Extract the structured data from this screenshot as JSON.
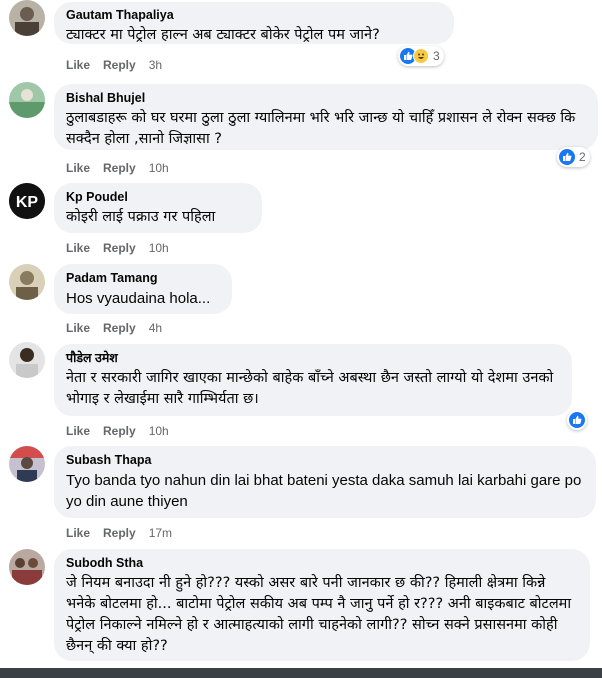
{
  "actions": {
    "like": "Like",
    "reply": "Reply"
  },
  "colors": {
    "bubble": "#f0f2f5",
    "like_blue": "#1877f2",
    "muted": "#65676b"
  },
  "comments": [
    {
      "name": "Gautam Thapaliya",
      "text": "ट्याक्टर मा पेट्रोल हाल्न अब ट्याक्टर बोकेर पेट्रोल पम जाने?",
      "time": "3h",
      "reaction_count": "3",
      "reactions": [
        "like-icon",
        "haha-icon"
      ]
    },
    {
      "name": "Bishal Bhujel",
      "text": "ठुलाबडाहरू को घर घरमा ठुला ठुला ग्यालिनमा भरि भरि जान्छ यो चाहिँ प्रशासन ले रोक्न सक्छ कि सक्दैन होला ,सानो जिज्ञासा ?",
      "time": "10h",
      "reaction_count": "2",
      "reactions": [
        "like-icon"
      ]
    },
    {
      "name": "Kp Poudel",
      "text": "कोइरी लाई पक्राउ गर पहिला",
      "time": "10h",
      "avatar_text": "KP"
    },
    {
      "name": "Padam Tamang",
      "text": "Hos vyaudaina hola...",
      "time": "4h"
    },
    {
      "name": "पौडेल उमेश",
      "text": "नेता र सरकारी जागिर खाएका मान्छेको बाहेक बाँच्ने अबस्था छैन जस्तो लाग्यो यो देशमा उनको भोगाइ र लेखाईमा सारै गाम्भिर्यता छ।",
      "time": "10h",
      "reactions": [
        "like-icon"
      ]
    },
    {
      "name": "Subash Thapa",
      "text": "Tyo banda tyo nahun din lai bhat bateni yesta daka samuh lai karbahi gare po yo din aune thiyen",
      "time": "17m"
    },
    {
      "name": "Subodh Stha",
      "text": "जे नियम बनाउदा नी हुने हो??? यस्को असर बारे पनी जानकार छ की?? हिमाली क्षेत्रमा किन्ने भनेके बोटलमा हो... बाटोमा पेट्रोल सकीय अब पम्प नै जानु पर्ने हो र??? अनी बाइकबाट बोटलमा पेट्रोल निकाल्ने नमिल्ने हो र आत्माहत्याको लागी चाहनेको लागी?? सोच्न सक्ने प्रसासनमा कोही छैनन् की क्या हो??"
    }
  ]
}
